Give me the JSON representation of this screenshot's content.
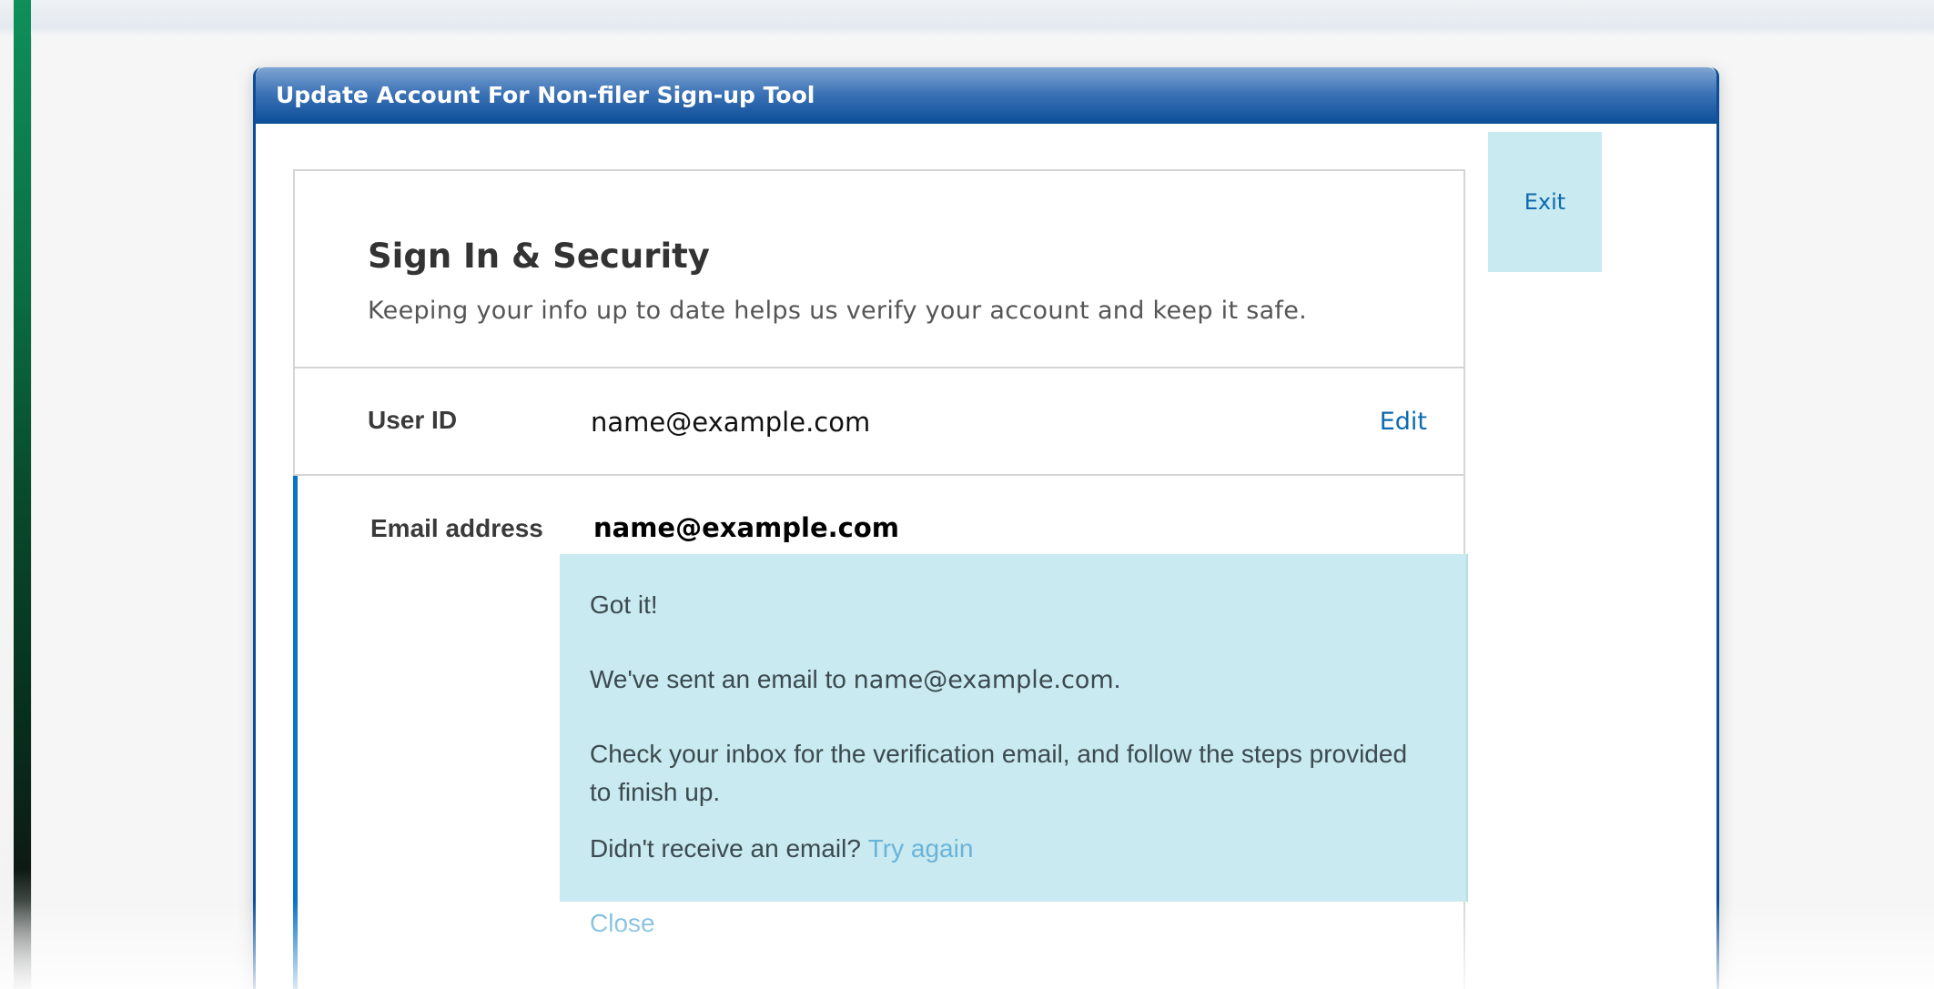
{
  "dialog": {
    "title": "Update Account For Non-filer Sign-up Tool",
    "exit_label": "Exit"
  },
  "card": {
    "title": "Sign In & Security",
    "subtitle": "Keeping your info up to date helps us verify your account and keep it safe."
  },
  "user_id": {
    "label": "User ID",
    "value": "name@example.com",
    "edit_label": "Edit"
  },
  "email": {
    "label": "Email address",
    "value": "name@example.com"
  },
  "notice": {
    "heading": "Got it!",
    "sent_prefix": "We've sent an email to",
    "sent_email": "name@example.com",
    "sent_suffix": ".",
    "instructions_line1": "Check your inbox for the verification email, and follow the steps provided",
    "instructions_line2": "to finish up.",
    "didnt_receive": "Didn't receive an email?",
    "try_again": "Try again",
    "close": "Close"
  },
  "colors": {
    "title_bar": "#0b4d98",
    "notice_bg": "#c9eaf0",
    "link": "#0c6ab0",
    "light_link": "#6ab3d9",
    "active_bar": "#0b72c8"
  }
}
